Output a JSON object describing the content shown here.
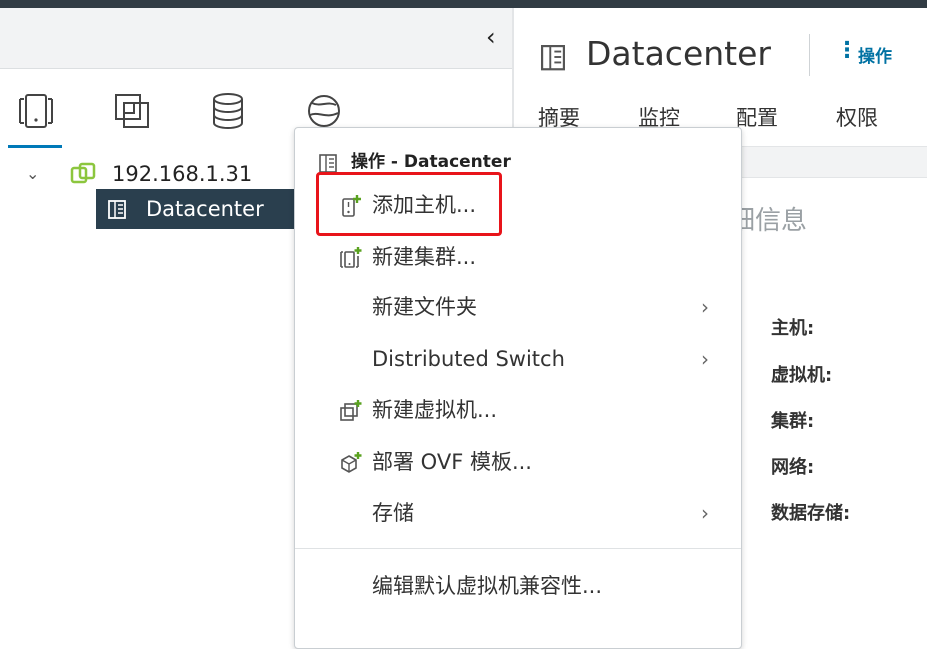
{
  "left_panel": {
    "tree": {
      "host": "192.168.1.31",
      "datacenter": "Datacenter"
    }
  },
  "right_panel": {
    "title": "Datacenter",
    "actions_label": "操作",
    "tabs": [
      "摘要",
      "监控",
      "配置",
      "权限"
    ],
    "info_title_partial": "细信息",
    "labels": [
      "主机:",
      "虚拟机:",
      "集群:",
      "网络:",
      "数据存储:"
    ]
  },
  "context_menu": {
    "header": "操作 - Datacenter",
    "items": [
      {
        "label": "添加主机...",
        "icon": "add-host-icon"
      },
      {
        "label": "新建集群...",
        "icon": "new-cluster-icon"
      },
      {
        "label": "新建文件夹",
        "submenu": true
      },
      {
        "label": "Distributed Switch",
        "submenu": true
      },
      {
        "label": "新建虚拟机...",
        "icon": "new-vm-icon"
      },
      {
        "label": "部署 OVF 模板...",
        "icon": "deploy-ovf-icon"
      },
      {
        "label": "存储",
        "submenu": true
      },
      {
        "label": "编辑默认虚拟机兼容性..."
      }
    ]
  },
  "colors": {
    "accent": "#0072a3",
    "selected_row": "#2a3f4e",
    "highlight_box": "#e8141a",
    "add_plus": "#5aa220"
  }
}
